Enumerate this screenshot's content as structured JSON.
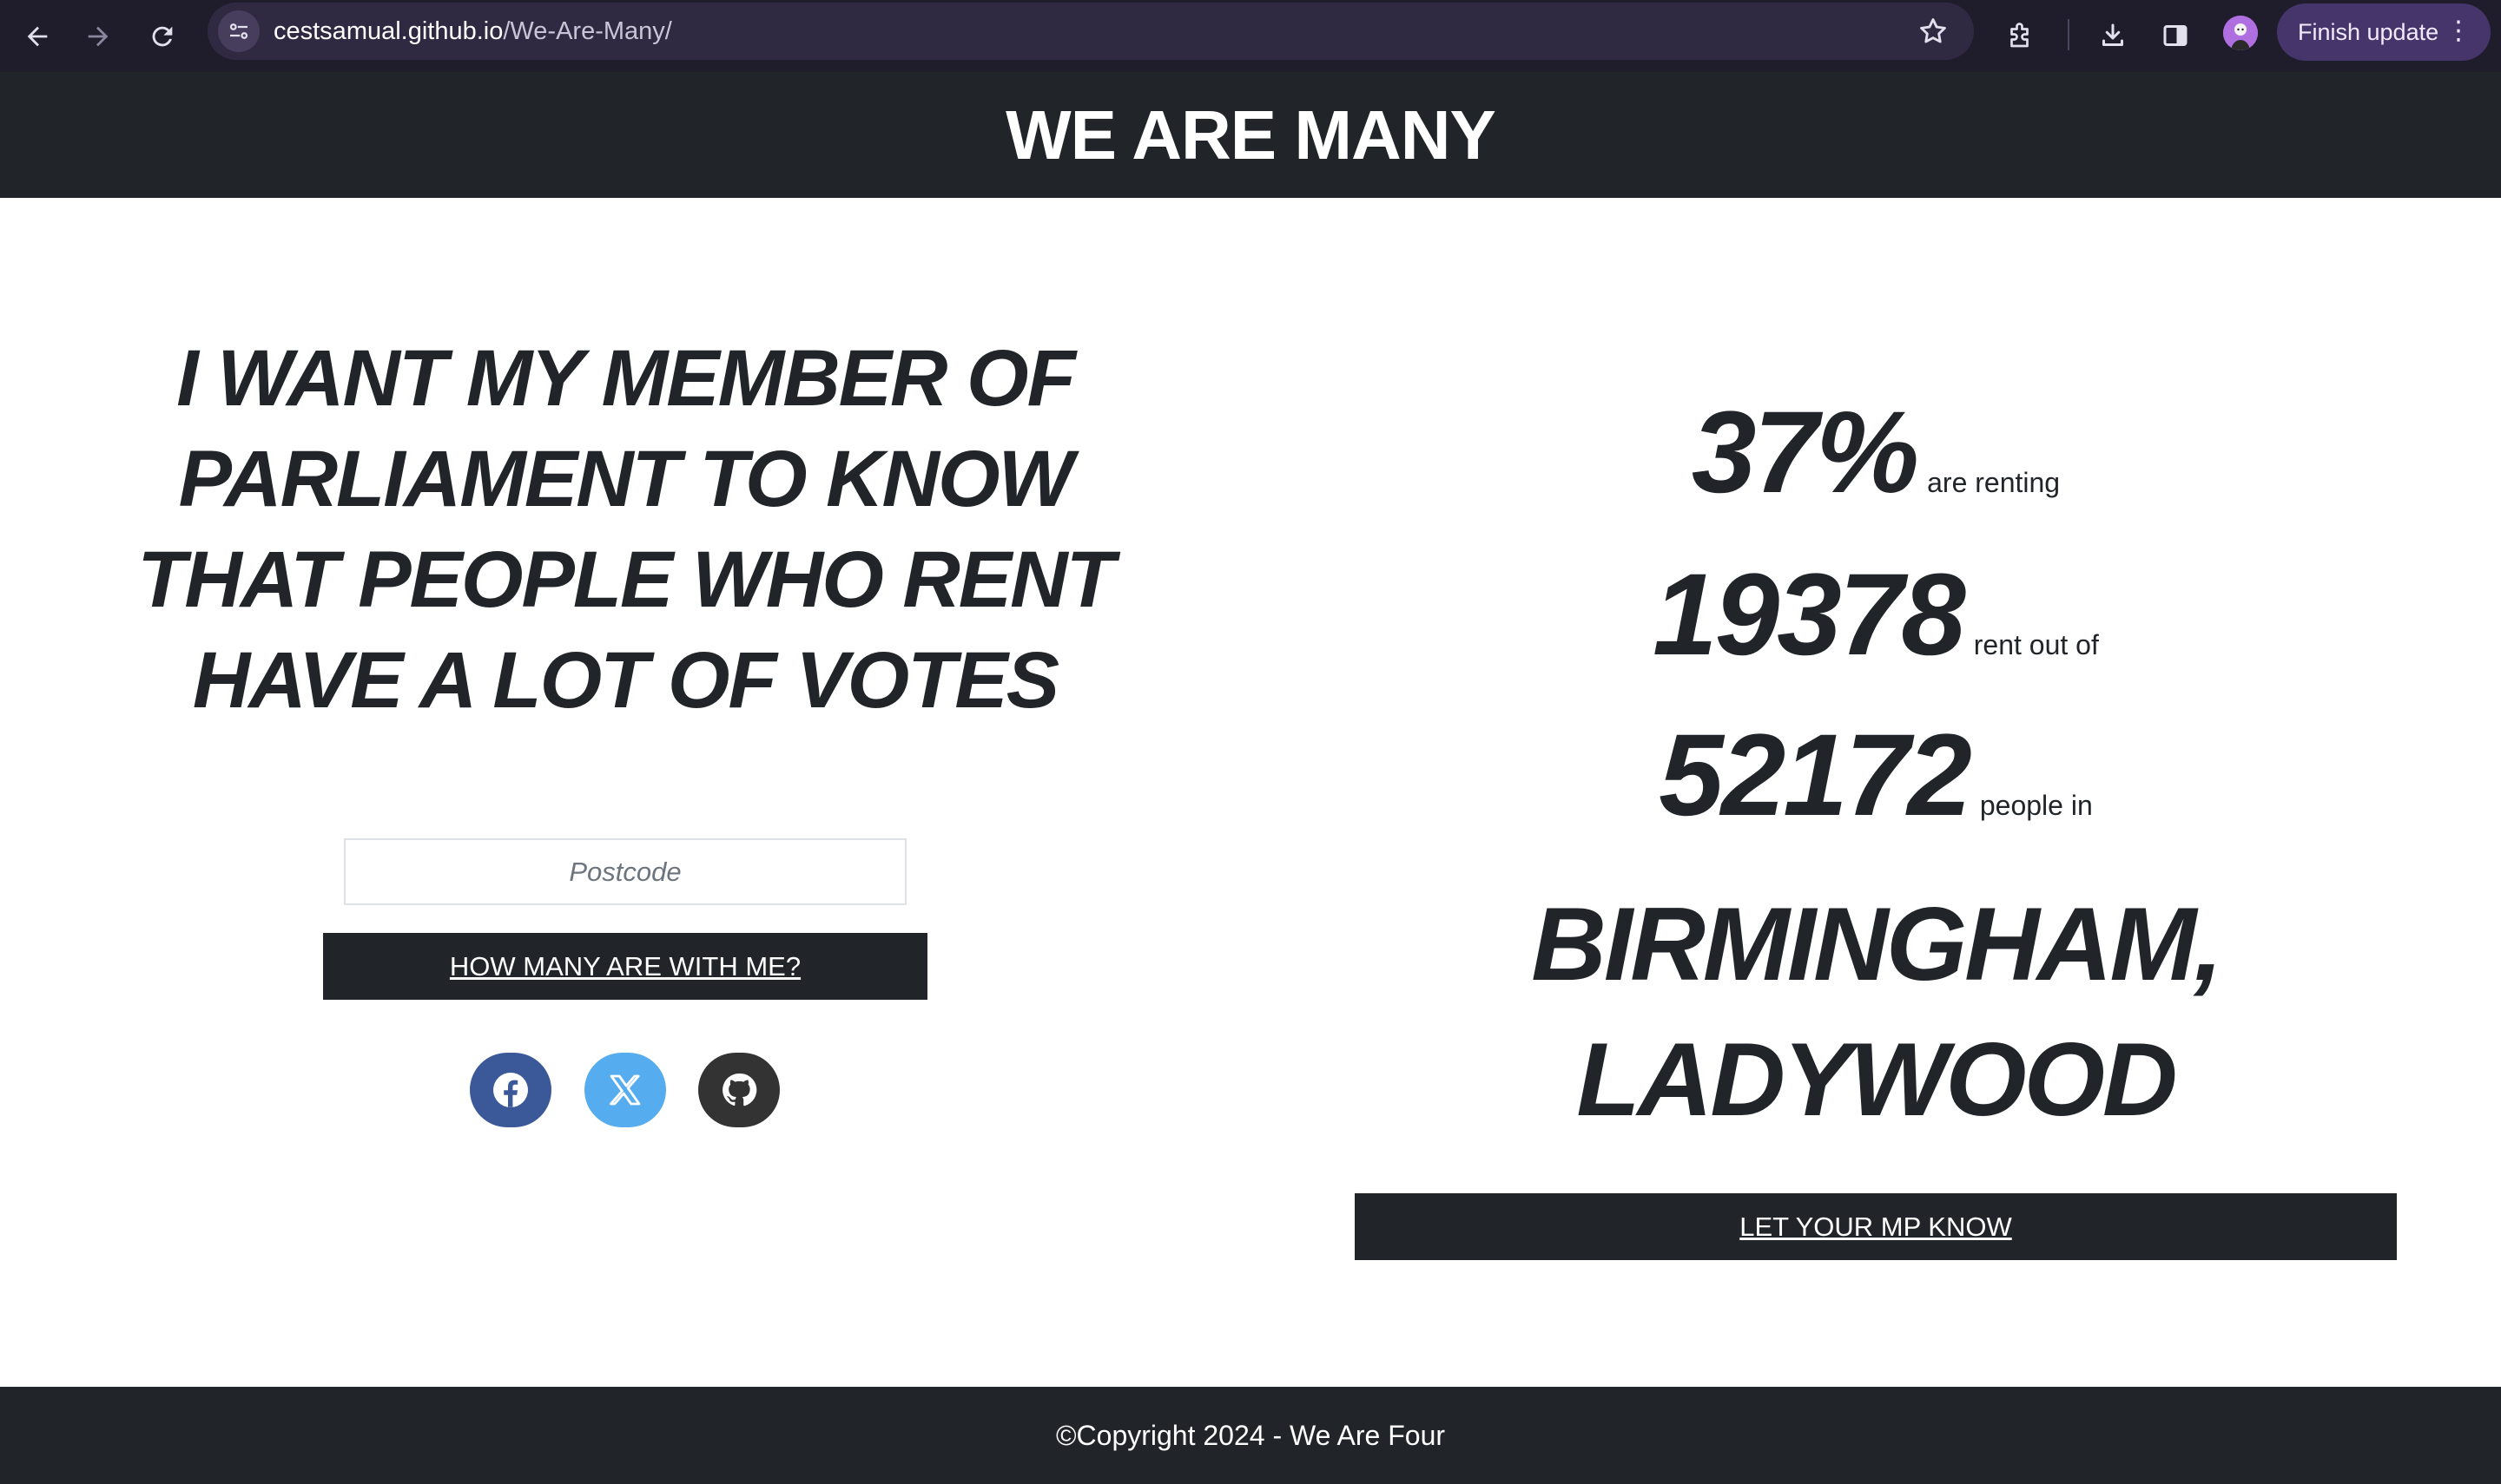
{
  "browser": {
    "url_host": "cestsamual.github.io",
    "url_path": "/We-Are-Many/",
    "finish_update_label": "Finish update",
    "menu_glyph": "⋮",
    "icons": [
      "back-icon",
      "forward-icon",
      "reload-icon",
      "site-info-icon",
      "bookmark-star-icon",
      "extensions-icon",
      "download-icon",
      "side-panel-icon",
      "profile-avatar"
    ]
  },
  "header": {
    "title": "WE ARE MANY"
  },
  "left": {
    "headline": "I WANT MY MEMBER OF PARLIAMENT TO KNOW THAT PEOPLE WHO RENT HAVE A LOT OF VOTES",
    "postcode_placeholder": "Postcode",
    "postcode_value": "",
    "submit_label": "HOW MANY ARE WITH ME?",
    "social": [
      {
        "name": "facebook",
        "color": "#3b5998"
      },
      {
        "name": "x",
        "color": "#55acee"
      },
      {
        "name": "github",
        "color": "#333333"
      }
    ]
  },
  "stats": {
    "percent": "37%",
    "percent_label": "are renting",
    "renters": "19378",
    "renters_label": "rent out of",
    "population": "52172",
    "population_label": "people in",
    "constituency_line1": "BIRMINGHAM,",
    "constituency_line2": "LADYWOOD",
    "cta_label": "LET YOUR MP KNOW"
  },
  "footer": {
    "copyright": "©Copyright 2024 - We Are Four"
  },
  "colors": {
    "dark": "#212529",
    "chrome_bg": "#1f1d2b",
    "omnibox_bg": "#2f2a42",
    "accent_purple": "#46356b"
  }
}
